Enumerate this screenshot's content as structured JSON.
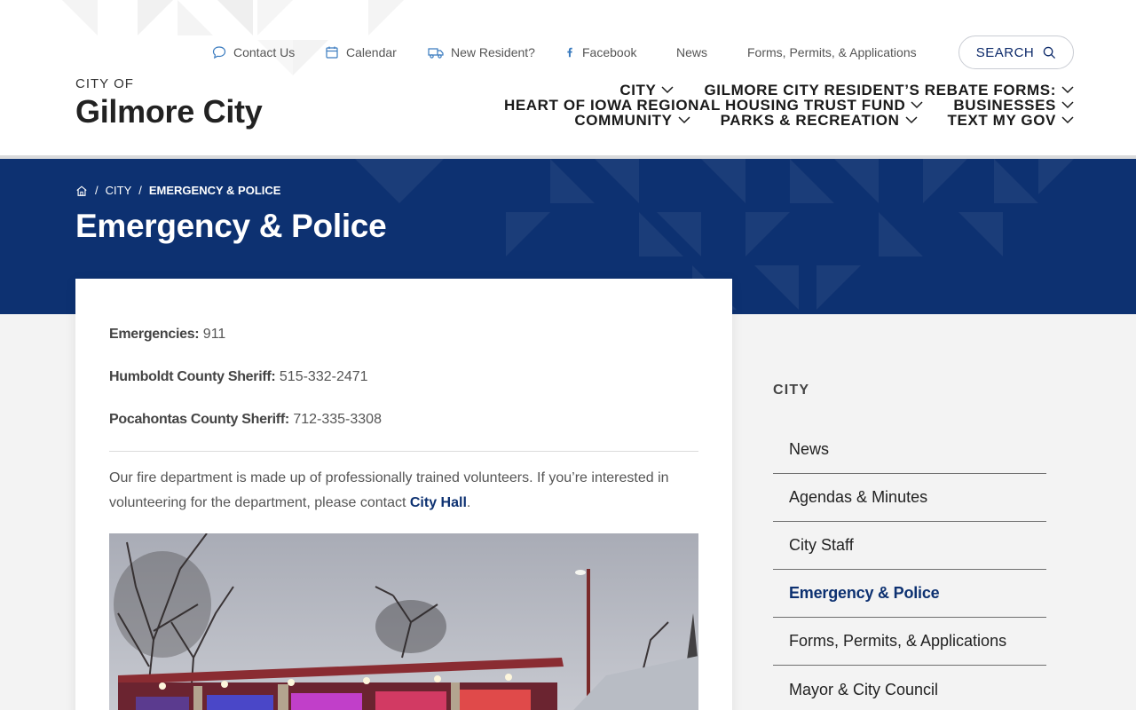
{
  "utility_nav": {
    "contact": "Contact Us",
    "calendar": "Calendar",
    "new_resident": "New Resident?",
    "facebook": "Facebook",
    "news": "News",
    "forms": "Forms, Permits, & Applications",
    "search": "SEARCH"
  },
  "logo": {
    "sub": "CITY OF",
    "main": "Gilmore City"
  },
  "main_nav": {
    "city": "CITY",
    "rebate": "GILMORE CITY RESIDENT’S REBATE FORMS:",
    "housing": "HEART OF IOWA REGIONAL HOUSING TRUST FUND",
    "businesses": "BUSINESSES",
    "community": "COMMUNITY",
    "parks": "PARKS & RECREATION",
    "textmygov": "TEXT MY GOV"
  },
  "breadcrumb": {
    "sep": "/",
    "city": "CITY",
    "current": "EMERGENCY & POLICE"
  },
  "page_title": "Emergency & Police",
  "content": {
    "emergencies_label": "Emergencies:",
    "emergencies_value": " 911",
    "humboldt_label": "Humboldt County Sheriff:",
    "humboldt_value": " 515-332-2471",
    "pocahontas_label": "Pocahontas County Sheriff:",
    "pocahontas_value": " 712-335-3308",
    "para_text": "Our fire department is made up of professionally trained volunteers. If you’re interested in volunteering for the department, please contact ",
    "para_link": "City Hall",
    "para_end": "."
  },
  "sidebar": {
    "heading": "CITY",
    "items": [
      "News",
      "Agendas & Minutes",
      "City Staff",
      "Emergency & Police",
      "Forms, Permits, & Applications",
      "Mayor & City Council"
    ]
  },
  "colors": {
    "brand_navy": "#0d3171",
    "accent_blue": "#3a7bbf"
  }
}
